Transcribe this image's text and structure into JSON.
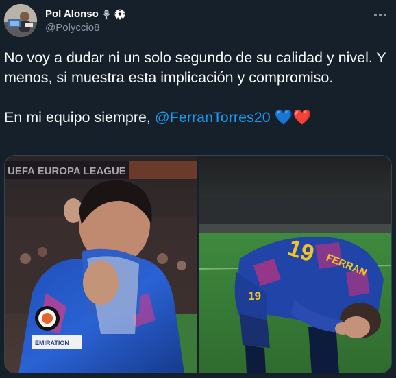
{
  "author": {
    "display_name": "Pol Alonso",
    "handle": "@Polyccio8",
    "badges": [
      "microphone-icon",
      "soccer-ball-icon"
    ]
  },
  "tweet": {
    "paragraph1": "No voy a dudar ni un solo segundo de su calidad y nivel. Y menos, si muestra esta implicación y compromiso.",
    "paragraph2_prefix": "En mi equipo siempre, ",
    "mention": "@FerranTorres20",
    "emojis": "💙❤️"
  },
  "media": {
    "left_banner_text": "UEFA EUROPA LEAGUE",
    "left_jersey_text": "EMIRATION",
    "right_jersey_name": "FERRAN",
    "right_jersey_number": "19"
  },
  "colors": {
    "background": "#15202b",
    "mention": "#1d9bf0",
    "secondary_text": "#8b98a5",
    "border": "#38444d"
  }
}
